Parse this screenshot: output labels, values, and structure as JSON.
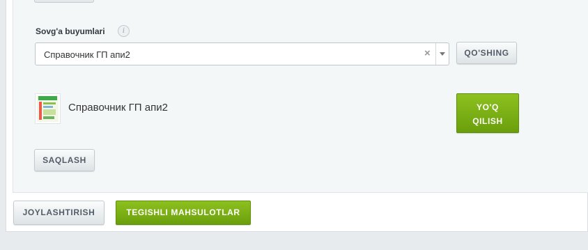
{
  "gift_items": {
    "label": "Sovg'a buyumlari",
    "info_icon": "info-icon",
    "selected_value": "Справочник ГП апи2",
    "clear_symbol": "×",
    "add_button": "QO'SHING"
  },
  "product": {
    "name": "Справочник ГП апи2",
    "remove_button_line1": "YO'Q",
    "remove_button_line2": "QILISH"
  },
  "save_button": "SAQLASH",
  "footer": {
    "placement_button": "JOYLASHTIRISH",
    "related_products_button": "TEGISHLI MAHSULOTLAR"
  },
  "colors": {
    "accent_green": "#7ab015",
    "panel_bg": "#f4f7f8"
  }
}
